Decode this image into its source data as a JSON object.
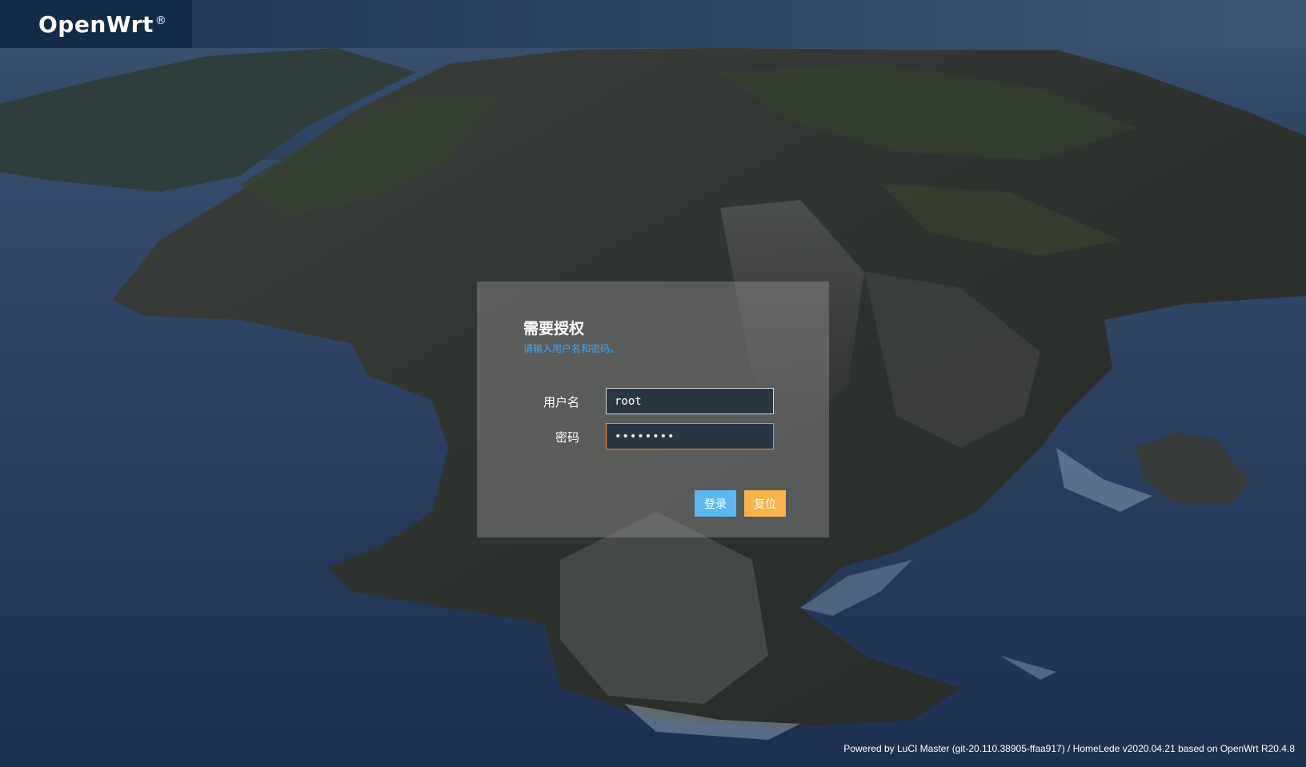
{
  "header": {
    "brand": "OpenWrt",
    "brand_mark": "®"
  },
  "login": {
    "title": "需要授权",
    "description": "请输入用户名和密码。",
    "username_label": "用户名",
    "username_value": "root",
    "password_label": "密码",
    "password_value": "password",
    "login_button": "登录",
    "reset_button": "复位"
  },
  "footer": {
    "text": "Powered by LuCI Master (git-20.110.38905-ffaa917) / HomeLede v2020.04.21 based on OpenWrt R20.4.8"
  },
  "colors": {
    "brand_bg": "#142b48",
    "header_bg": "#2b4260",
    "link_blue": "#3fa7f5",
    "login_button": "#5cb7f3",
    "reset_button": "#f8b34a",
    "focus_border": "#f0903a"
  }
}
